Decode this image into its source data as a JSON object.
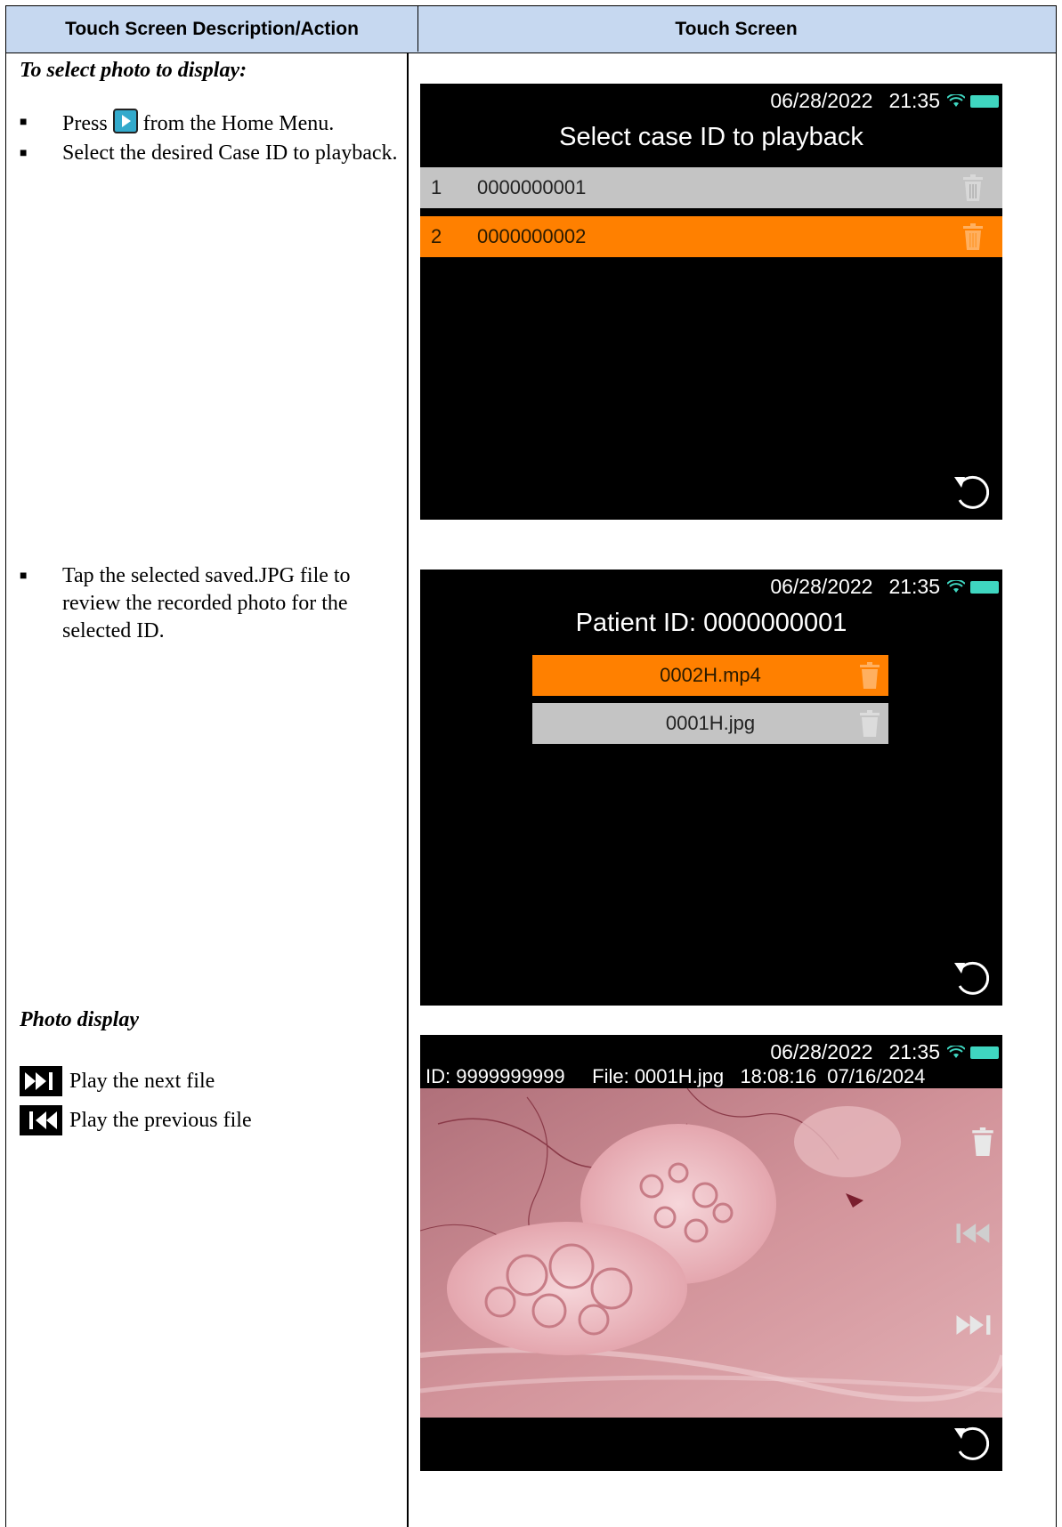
{
  "header": {
    "left": "Touch Screen Description/Action",
    "right": "Touch Screen"
  },
  "left_column": {
    "section1_title": "To select photo to display:",
    "bullet1_a": "Press",
    "bullet1_b": "from the Home Menu.",
    "bullet2": "Select the desired Case ID to playback.",
    "bullet3": "Tap the selected saved.JPG file to review the recorded photo for the selected ID.",
    "section2_title": "Photo display",
    "legend_next": "Play the next file",
    "legend_prev": "Play the previous file",
    "bullet_glyph": "■"
  },
  "screen1": {
    "date": "06/28/2022",
    "time": "21:35",
    "title": "Select case ID to playback",
    "rows": [
      {
        "num": "1",
        "id": "0000000001"
      },
      {
        "num": "2",
        "id": "0000000002"
      }
    ]
  },
  "screen2": {
    "date": "06/28/2022",
    "time": "21:35",
    "title": "Patient ID: 0000000001",
    "files": [
      "0002H.mp4",
      "0001H.jpg"
    ]
  },
  "screen3": {
    "date": "06/28/2022",
    "time": "21:35",
    "info": "ID: 9999999999     File: 0001H.jpg   18:08:16  07/16/2024"
  },
  "colors": {
    "header_bg": "#c6d8f0",
    "orange": "#ff8000",
    "gray_row": "#c4c4c4",
    "battery": "#3fd6c0"
  },
  "icons": [
    "play-icon",
    "trash-icon",
    "undo-icon",
    "wifi-icon",
    "battery-icon",
    "next-file-icon",
    "previous-file-icon"
  ]
}
